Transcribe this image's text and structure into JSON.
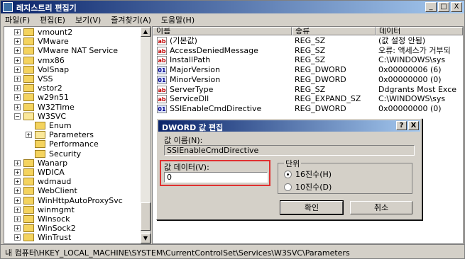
{
  "window": {
    "title": "레지스트리 편집기",
    "controls": {
      "minimize": "_",
      "maximize": "□",
      "close": "X"
    }
  },
  "menu": [
    "파일(F)",
    "편집(E)",
    "보기(V)",
    "즐겨찾기(A)",
    "도움말(H)"
  ],
  "tree": {
    "items": [
      {
        "label": "vmount2",
        "expander": "+"
      },
      {
        "label": "VMware",
        "expander": "+"
      },
      {
        "label": "VMware NAT Service",
        "expander": "+"
      },
      {
        "label": "vmx86",
        "expander": "+"
      },
      {
        "label": "VolSnap",
        "expander": "+"
      },
      {
        "label": "VSS",
        "expander": "+"
      },
      {
        "label": "vstor2",
        "expander": "+"
      },
      {
        "label": "w29n51",
        "expander": "+"
      },
      {
        "label": "W32Time",
        "expander": "+"
      },
      {
        "label": "W3SVC",
        "expander": "−"
      },
      {
        "label": "Enum",
        "expander": ""
      },
      {
        "label": "Parameters",
        "expander": "+"
      },
      {
        "label": "Performance",
        "expander": ""
      },
      {
        "label": "Security",
        "expander": ""
      },
      {
        "label": "Wanarp",
        "expander": "+"
      },
      {
        "label": "WDICA",
        "expander": "+"
      },
      {
        "label": "wdmaud",
        "expander": "+"
      },
      {
        "label": "WebClient",
        "expander": "+"
      },
      {
        "label": "WinHttpAutoProxySvc",
        "expander": "+"
      },
      {
        "label": "winmgmt",
        "expander": "+"
      },
      {
        "label": "Winsock",
        "expander": "+"
      },
      {
        "label": "WinSock2",
        "expander": "+"
      },
      {
        "label": "WinTrust",
        "expander": "+"
      }
    ]
  },
  "list": {
    "columns": [
      "이름",
      "종류",
      "데이터"
    ],
    "rows": [
      {
        "icon": "ab",
        "name": "(기본값)",
        "type": "REG_SZ",
        "data": "(값 설정 안됨)"
      },
      {
        "icon": "ab",
        "name": "AccessDeniedMessage",
        "type": "REG_SZ",
        "data": "오류: 액세스가 거부되"
      },
      {
        "icon": "ab",
        "name": "InstallPath",
        "type": "REG_SZ",
        "data": "C:\\WINDOWS\\sys"
      },
      {
        "icon": "bin",
        "name": "MajorVersion",
        "type": "REG_DWORD",
        "data": "0x00000006 (6)"
      },
      {
        "icon": "bin",
        "name": "MinorVersion",
        "type": "REG_DWORD",
        "data": "0x00000000 (0)"
      },
      {
        "icon": "ab",
        "name": "ServerType",
        "type": "REG_SZ",
        "data": "Ddgrants Most Exce"
      },
      {
        "icon": "ab",
        "name": "ServiceDll",
        "type": "REG_EXPAND_SZ",
        "data": "C:\\WINDOWS\\sys"
      },
      {
        "icon": "bin",
        "name": "SSIEnableCmdDirective",
        "type": "REG_DWORD",
        "data": "0x00000000 (0)"
      }
    ]
  },
  "status_path": "내 컴퓨터\\HKEY_LOCAL_MACHINE\\SYSTEM\\CurrentControlSet\\Services\\W3SVC\\Parameters",
  "dialog": {
    "title": "DWORD 값 편집",
    "controls": {
      "help": "?",
      "close": "X"
    },
    "value_name_label": "값 이름(N):",
    "value_name": "SSIEnableCmdDirective",
    "value_data_label": "값 데이터(V):",
    "value_data": "0",
    "base_label": "단위",
    "base_options": [
      {
        "label": "16진수(H)",
        "checked": true
      },
      {
        "label": "10진수(D)",
        "checked": false
      }
    ],
    "ok_label": "확인",
    "cancel_label": "취소"
  },
  "colors": {
    "title_start": "#0a246a",
    "title_end": "#a6caf0",
    "highlight_box": "#e03030",
    "face": "#d4d0c8"
  }
}
